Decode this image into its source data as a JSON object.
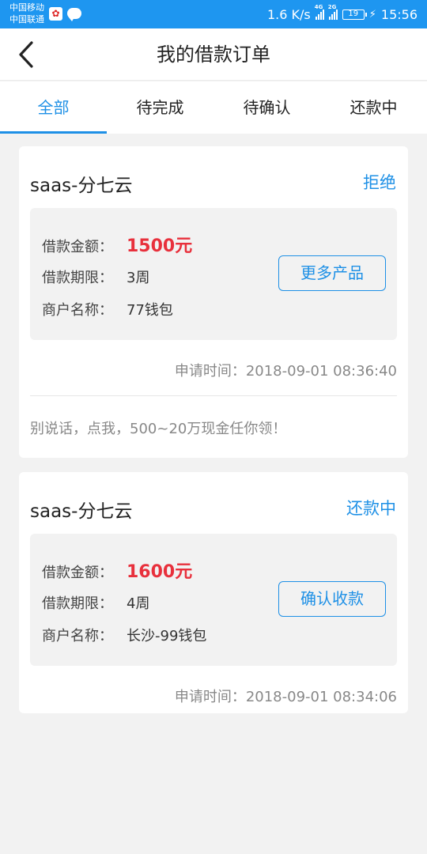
{
  "status_bar": {
    "carrier_1": "中国移动",
    "carrier_2": "中国联通",
    "net_speed": "1.6 K/s",
    "net_type_1": "4G",
    "net_type_2": "2G",
    "battery": "19",
    "time": "15:56"
  },
  "header": {
    "title": "我的借款订单"
  },
  "tabs": [
    {
      "label": "全部"
    },
    {
      "label": "待完成"
    },
    {
      "label": "待确认"
    },
    {
      "label": "还款中"
    }
  ],
  "orders": [
    {
      "title": "saas-分七云",
      "status": "拒绝",
      "amount_label": "借款金额：",
      "amount": "1500元",
      "term_label": "借款期限：",
      "term": "3周",
      "merchant_label": "商户名称：",
      "merchant": "77钱包",
      "button": "更多产品",
      "apply_time_label": "申请时间：",
      "apply_time": "2018-09-01 08:36:40",
      "promo": "别说话，点我，500~20万现金任你领！"
    },
    {
      "title": "saas-分七云",
      "status": "还款中",
      "amount_label": "借款金额：",
      "amount": "1600元",
      "term_label": "借款期限：",
      "term": "4周",
      "merchant_label": "商户名称：",
      "merchant": "长沙-99钱包",
      "button": "确认收款",
      "apply_time_label": "申请时间：",
      "apply_time": "2018-09-01 08:34:06"
    }
  ],
  "colors": {
    "accent": "#1e90e6",
    "status_bar": "#1e96f0",
    "amount": "#e8303c",
    "background": "#f2f2f2"
  }
}
